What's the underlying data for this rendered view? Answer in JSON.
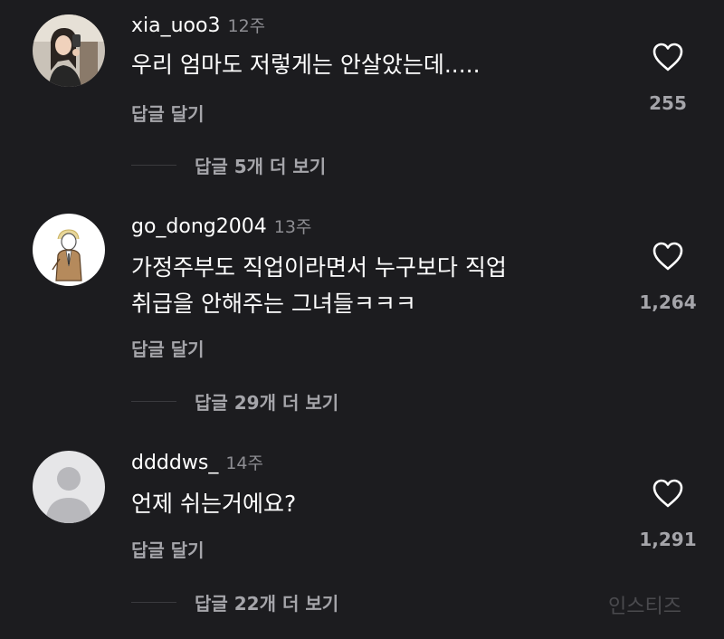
{
  "comments": [
    {
      "username": "xia_uoo3",
      "time": "12주",
      "text_lines": [
        "우리 엄마도 저렇게는 안살았는데....."
      ],
      "reply_label": "답글 달기",
      "likes": "255",
      "view_replies": "답글 5개 더 보기",
      "avatar_icon": "user-photo-avatar"
    },
    {
      "username": "go_dong2004",
      "time": "13주",
      "text_lines": [
        "가정주부도 직업이라면서 누구보다 직업",
        "취급을 안해주는 그녀들ㅋㅋㅋ"
      ],
      "reply_label": "답글 달기",
      "likes": "1,264",
      "view_replies": "답글 29개 더 보기",
      "avatar_icon": "illustrated-figure-avatar"
    },
    {
      "username": "ddddws_",
      "time": "14주",
      "text_lines": [
        "언제 쉬는거에요?"
      ],
      "reply_label": "답글 달기",
      "likes": "1,291",
      "view_replies": "답글 22개 더 보기",
      "avatar_icon": "default-person-avatar"
    }
  ],
  "watermark": "인스티즈",
  "colors": {
    "background": "#1c1c1f",
    "primary_text": "#ffffff",
    "secondary_text": "#a5a5aa",
    "time_text": "#8e8e93"
  }
}
